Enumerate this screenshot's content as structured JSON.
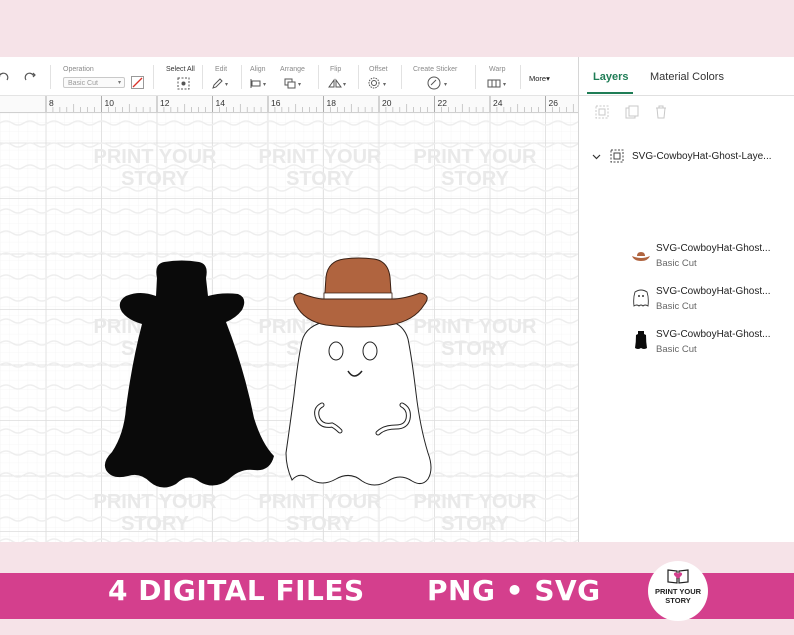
{
  "colors": {
    "accent": "#1f7d56",
    "banner": "#d43f8d",
    "hat": "#b0643f",
    "background": "#f6e3e8"
  },
  "toolbar": {
    "operation_label": "Operation",
    "operation_value": "Basic Cut",
    "select_all_label": "Select All",
    "edit_label": "Edit",
    "align_label": "Align",
    "arrange_label": "Arrange",
    "flip_label": "Flip",
    "offset_label": "Offset",
    "create_sticker_label": "Create Sticker",
    "warp_label": "Warp",
    "more_label": "More"
  },
  "ruler": {
    "ticks": [
      "8",
      "10",
      "12",
      "14",
      "16",
      "18",
      "20",
      "22",
      "24",
      "26"
    ]
  },
  "panel": {
    "tabs": [
      "Layers",
      "Material Colors"
    ],
    "group_name": "SVG-CowboyHat-Ghost-Laye...",
    "layers": [
      {
        "name": "SVG-CowboyHat-Ghost...",
        "operation": "Basic Cut",
        "icon": "hat-thumb-icon"
      },
      {
        "name": "SVG-CowboyHat-Ghost...",
        "operation": "Basic Cut",
        "icon": "ghost-outline-thumb-icon"
      },
      {
        "name": "SVG-CowboyHat-Ghost...",
        "operation": "Basic Cut",
        "icon": "ghost-silhouette-thumb-icon"
      }
    ]
  },
  "watermark": {
    "line1": "PRINT YOUR",
    "line2": "STORY"
  },
  "banner": {
    "files_text": "4 DIGITAL FILES",
    "formats_text": "PNG • SVG",
    "logo_line1": "PRINT YOUR",
    "logo_line2": "STORY"
  }
}
